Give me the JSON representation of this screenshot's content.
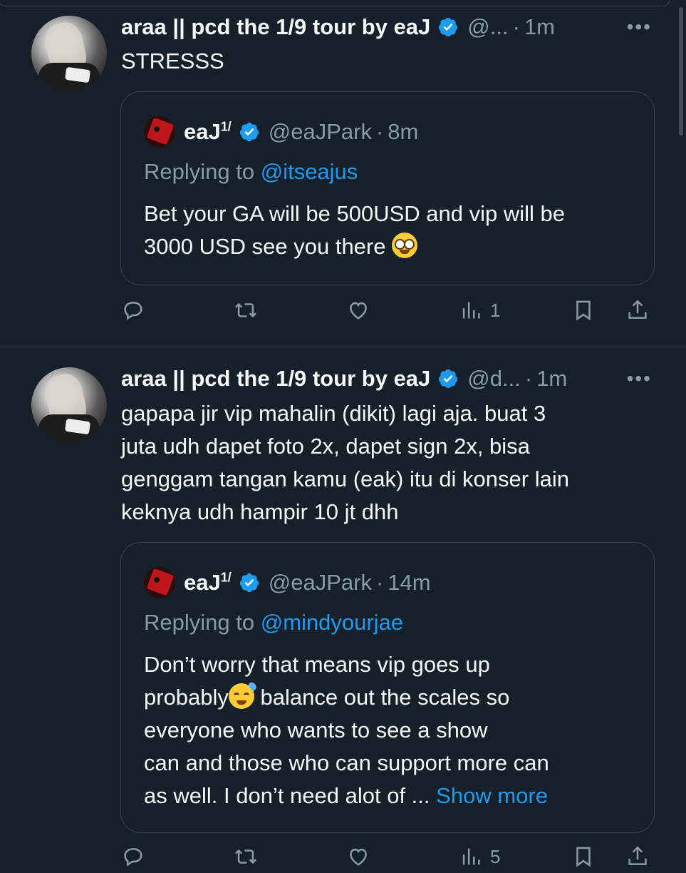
{
  "tweets": [
    {
      "name": "araa || pcd the 1/9 tour by eaJ",
      "handle": "@...",
      "time": "1m",
      "text": "STRESSS",
      "quote": {
        "name": "eaJ",
        "name_sup": "1/",
        "handle": "@eaJPark",
        "time": "8m",
        "replying_prefix": "Replying to ",
        "replying_to": "@itseajus",
        "text_line1": "Bet your GA will be 500USD and vip will be",
        "text_line2": "3000 USD see you there"
      },
      "views": "1"
    },
    {
      "name": "araa || pcd the 1/9 tour by eaJ",
      "handle": "@d...",
      "time": "1m",
      "text_lines": [
        "gapapa jir vip mahalin (dikit) lagi aja. buat 3",
        "juta udh dapet foto 2x, dapet sign 2x, bisa",
        "genggam tangan kamu (eak) itu di konser lain",
        "keknya udh hampir 10 jt dhh"
      ],
      "quote": {
        "name": "eaJ",
        "name_sup": "1/",
        "handle": "@eaJPark",
        "time": "14m",
        "replying_prefix": "Replying to ",
        "replying_to": "@mindyourjae",
        "line1": "Don’t worry that means vip goes up",
        "line2a": "probably",
        "line2b": " balance out the scales so",
        "line3": "everyone who wants to see a show",
        "line4": "can and those who can support more can",
        "line5": "as well. I don’t need alot of ...",
        "show_more": "Show more"
      },
      "views": "5"
    }
  ],
  "colors": {
    "background": "#15202b",
    "accent": "#1d9bf0",
    "muted": "#8b98a5",
    "border": "#38444d"
  },
  "icons": [
    "reply-icon",
    "retweet-icon",
    "like-icon",
    "views-icon",
    "bookmark-icon",
    "share-icon",
    "verified-badge-icon",
    "more-icon"
  ]
}
